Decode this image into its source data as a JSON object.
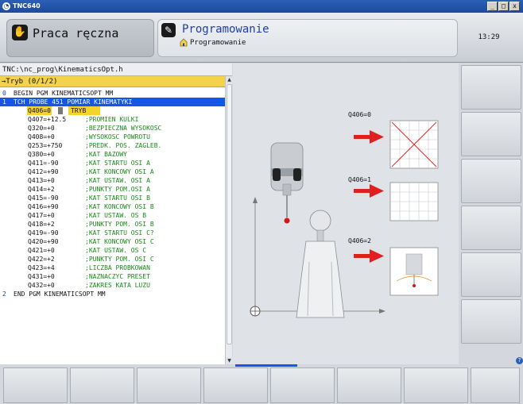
{
  "window": {
    "title": "TNC640"
  },
  "header": {
    "manual_mode": "Praca ręczna",
    "prog_mode": "Programowanie",
    "prog_submode": "Programowanie",
    "clock": "13:29"
  },
  "program": {
    "path": "TNC:\\nc_prog\\KinematicsOpt.h",
    "filter": "→Tryb (0/1/2)",
    "lines": [
      {
        "num": "0",
        "text": "BEGIN PGM KINEMATICSOPT MM"
      },
      {
        "num": "1",
        "text": "TCH PROBE 451 POMIAR KINEMATYKI"
      },
      {
        "param": "Q406=0",
        "comment": "TRYB"
      },
      {
        "param": "Q407=+12.5",
        "comment": ";PROMIEN KULKI"
      },
      {
        "param": "Q320=+0",
        "comment": ";BEZPIECZNA WYSOKOSC"
      },
      {
        "param": "Q408=+0",
        "comment": ";WYSOKOSC POWROTU"
      },
      {
        "param": "Q253=+750",
        "comment": ";PREDK. POS. ZAGLEB."
      },
      {
        "param": "Q380=+0",
        "comment": ";KAT BAZOWY"
      },
      {
        "param": "Q411=-90",
        "comment": ";KAT STARTU OSI A"
      },
      {
        "param": "Q412=+90",
        "comment": ";KAT KONCOWY OSI A"
      },
      {
        "param": "Q413=+0",
        "comment": ";KAT USTAW. OSI A"
      },
      {
        "param": "Q414=+2",
        "comment": ";PUNKTY POM.OSI A"
      },
      {
        "param": "Q415=-90",
        "comment": ";KAT STARTU OSI B"
      },
      {
        "param": "Q416=+90",
        "comment": ";KAT KONCOWY OSI B"
      },
      {
        "param": "Q417=+0",
        "comment": ";KAT USTAW. OS B"
      },
      {
        "param": "Q418=+2",
        "comment": ";PUNKTY POM. OSI B"
      },
      {
        "param": "Q419=-90",
        "comment": ";KAT STARTU OSI C?"
      },
      {
        "param": "Q420=+90",
        "comment": ";KAT KONCOWY OSI C"
      },
      {
        "param": "Q421=+0",
        "comment": ";KAT USTAW. OS C"
      },
      {
        "param": "Q422=+2",
        "comment": ";PUNKTY POM. OSI C"
      },
      {
        "param": "Q423=+4",
        "comment": ";LICZBA PROBKOWAN"
      },
      {
        "param": "Q431=+0",
        "comment": ";NAZNACZYC PRESET"
      },
      {
        "param": "Q432=+0",
        "comment": ";ZAKRES KATA LUZU"
      },
      {
        "num": "2",
        "text": "END PGM KINEMATICSOPT MM"
      }
    ]
  },
  "graphic": {
    "labels": [
      "Q406=0",
      "Q406=1",
      "Q406=2"
    ],
    "colors": {
      "arrow": "#e02020",
      "selection": "#1656e6",
      "filter": "#f2d34a"
    }
  }
}
